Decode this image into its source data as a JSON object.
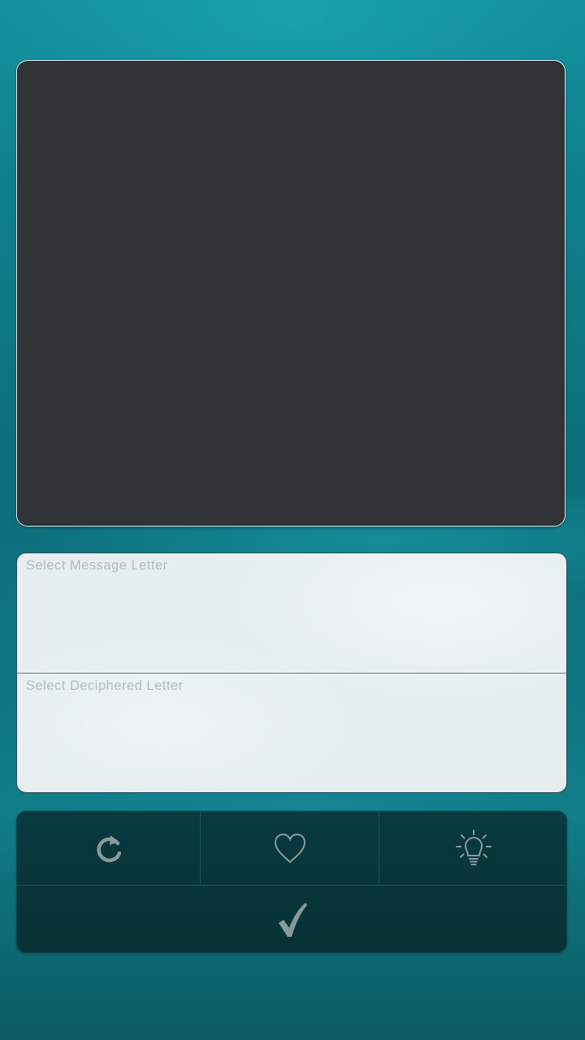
{
  "display_panel": {
    "message_text": ""
  },
  "selectors": {
    "message_letter_label": "Select Message Letter",
    "deciphered_letter_label": "Select Deciphered Letter"
  },
  "controls": {
    "buttons": [
      {
        "id": "refresh",
        "icon": "refresh-icon"
      },
      {
        "id": "favorite",
        "icon": "heart-icon"
      },
      {
        "id": "hint",
        "icon": "lightbulb-icon"
      },
      {
        "id": "submit",
        "icon": "checkmark-icon"
      }
    ],
    "icon_color": "#8a9a9c"
  },
  "colors": {
    "background_teal": "#0f7f8c",
    "display_dark": "#313436",
    "selector_light": "#e6eef0",
    "controls_dark": "#083a3f"
  }
}
